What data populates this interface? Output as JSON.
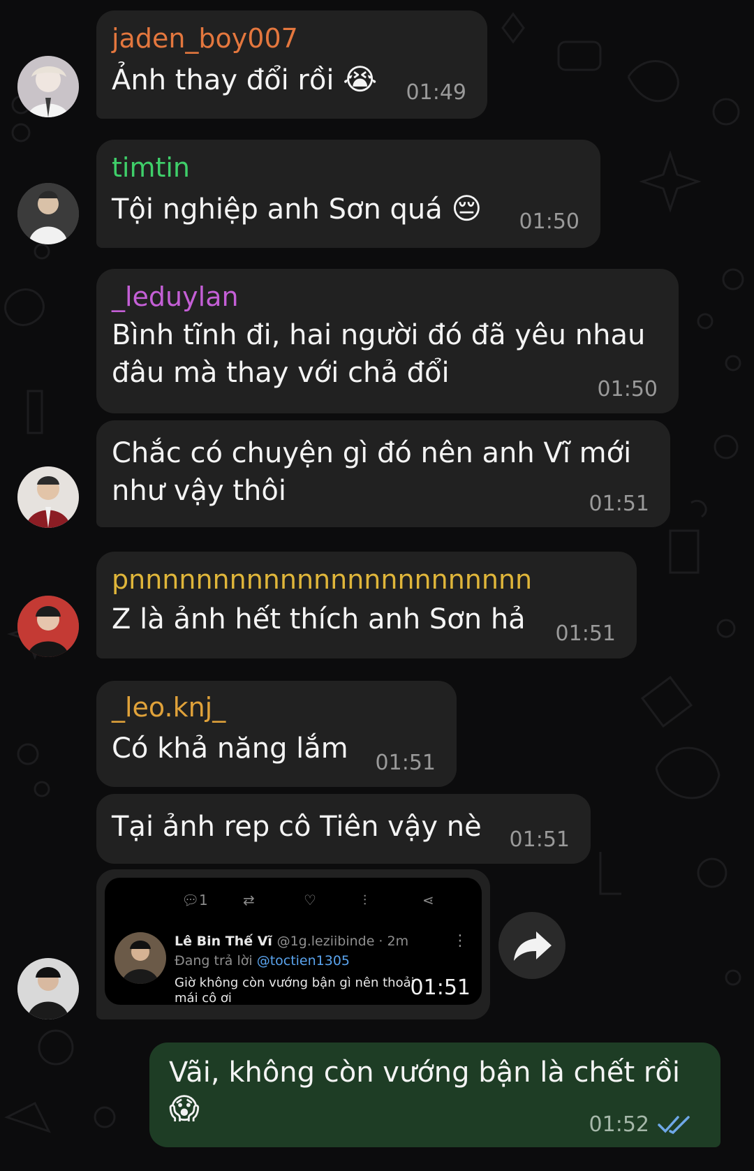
{
  "colors": {
    "background": "#0c0c0d",
    "bubble_in": "#212121",
    "bubble_out": "#1e3d25",
    "timestamp": "#9a9a9a",
    "read_check": "#6fa8e8"
  },
  "messages": [
    {
      "sender": "jaden_boy007",
      "sender_color": "#e4773e",
      "text": "Ảnh thay đổi rồi",
      "emoji": "😭",
      "time": "01:49"
    },
    {
      "sender": "timtin",
      "sender_color": "#3fcf6a",
      "text": "Tội nghiệp anh Sơn quá",
      "emoji": "😔",
      "time": "01:50"
    },
    {
      "sender": "_leduylan",
      "sender_color": "#c45fd6",
      "text_lines": [
        "Bình tĩnh đi, hai người đó đã yêu nhau",
        "đâu mà thay với chả đổi"
      ],
      "time": "01:50"
    },
    {
      "sender": "",
      "text_lines": [
        "Chắc có chuyện gì đó nên anh Vĩ mới",
        "như vậy thôi"
      ],
      "time": "01:51"
    },
    {
      "sender": "pnnnnnnnnnnnnnnnnnnnnnnnn",
      "sender_color": "#e0b63a",
      "text": "Z là ảnh hết thích anh Sơn hả",
      "time": "01:51"
    },
    {
      "sender": "_leo.knj_",
      "sender_color": "#e0a23a",
      "text": "Có khả năng lắm",
      "time": "01:51"
    },
    {
      "sender": "",
      "text": "Tại ảnh rep cô Tiên vậy nè",
      "time": "01:51"
    },
    {
      "sender": "",
      "time": "01:51",
      "tweet": {
        "reply_count": "1",
        "author_name": "Lê Bin Thế Vĩ",
        "author_handle": "@1g.leziibinde · 2m",
        "replying_prefix": "Đang trả lời",
        "replying_to": "@toctien1305",
        "text": "Giờ không còn vướng bận gì nên thoải mái cô ơi"
      }
    }
  ],
  "outgoing": {
    "text": "Vãi, không còn vướng bận là chết rồi",
    "emoji": "😱",
    "time": "01:52"
  }
}
